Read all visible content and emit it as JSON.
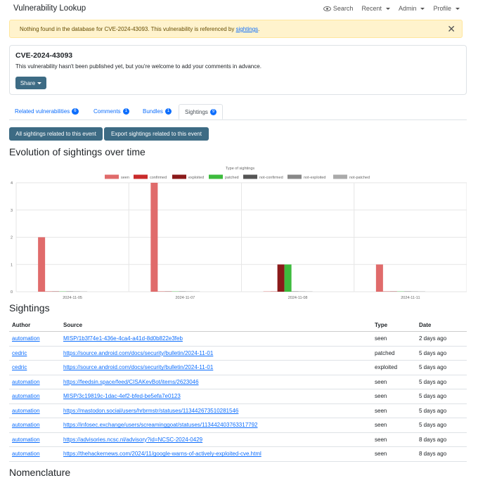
{
  "navbar": {
    "brand": "Vulnerability Lookup",
    "search": "Search",
    "recent": "Recent",
    "admin": "Admin",
    "profile": "Profile"
  },
  "alert": {
    "text": "Nothing found in the database for CVE-2024-43093. This vulnerability is referenced by ",
    "link": "sightings",
    "suffix": "."
  },
  "card": {
    "title": "CVE-2024-43093",
    "description": "This vulnerability hasn't been published yet, but you're welcome to add your comments in advance.",
    "share": "Share"
  },
  "tabs": [
    {
      "label": "Related vulnerabilities",
      "count": "6"
    },
    {
      "label": "Comments",
      "count": "1"
    },
    {
      "label": "Bundles",
      "count": "1"
    },
    {
      "label": "Sightings",
      "count": "9"
    }
  ],
  "buttons": {
    "all_sightings": "All sightings related to this event",
    "export_sightings": "Export sightings related to this event"
  },
  "headings": {
    "evolution": "Evolution of sightings over time",
    "sightings": "Sightings",
    "nomenclature": "Nomenclature"
  },
  "chart_data": {
    "type": "bar",
    "title": "Type of sightings",
    "categories": [
      "2024-11-05",
      "2024-11-07",
      "2024-11-08",
      "2024-11-11"
    ],
    "ylim": [
      0,
      4
    ],
    "yticks": [
      "0",
      "1",
      "2",
      "3",
      "4"
    ],
    "legend_position": "top",
    "grid": true,
    "series": [
      {
        "name": "seen",
        "color": "#e06b6b",
        "values": [
          2,
          4,
          0,
          1
        ]
      },
      {
        "name": "confirmed",
        "color": "#c92b2b",
        "values": [
          0,
          0,
          0,
          0
        ]
      },
      {
        "name": "exploited",
        "color": "#8b1a1a",
        "values": [
          0,
          0,
          1,
          0
        ]
      },
      {
        "name": "patched",
        "color": "#3dbb3d",
        "values": [
          0,
          0,
          1,
          0
        ]
      },
      {
        "name": "not-confirmed",
        "color": "#555555",
        "values": [
          0,
          0,
          0,
          0
        ]
      },
      {
        "name": "not-exploited",
        "color": "#888888",
        "values": [
          0,
          0,
          0,
          0
        ]
      },
      {
        "name": "not-patched",
        "color": "#aaaaaa",
        "values": [
          0,
          0,
          0,
          0
        ]
      }
    ]
  },
  "table": {
    "headers": [
      "Author",
      "Source",
      "Type",
      "Date"
    ],
    "rows": [
      {
        "author": "automation",
        "source": "MISP/1b3f74e1-436e-4ca4-a41d-8d0b822e3feb",
        "type": "seen",
        "date": "2 days ago"
      },
      {
        "author": "cedric",
        "source": "https://source.android.com/docs/security/bulletin/2024-11-01",
        "type": "patched",
        "date": "5 days ago"
      },
      {
        "author": "cedric",
        "source": "https://source.android.com/docs/security/bulletin/2024-11-01",
        "type": "exploited",
        "date": "5 days ago"
      },
      {
        "author": "automation",
        "source": "https://feedsin.space/feed/CISAKevBot/items/2623046",
        "type": "seen",
        "date": "5 days ago"
      },
      {
        "author": "automation",
        "source": "MISP/3c19819c-1dac-4ef2-bfed-be5efa7e0123",
        "type": "seen",
        "date": "5 days ago"
      },
      {
        "author": "automation",
        "source": "https://mastodon.social/users/hrbrmstr/statuses/113442673510281546",
        "type": "seen",
        "date": "5 days ago"
      },
      {
        "author": "automation",
        "source": "https://infosec.exchange/users/screaminggoat/statuses/113442403763317792",
        "type": "seen",
        "date": "5 days ago"
      },
      {
        "author": "automation",
        "source": "https://advisories.ncsc.nl/advisory?id=NCSC-2024-0429",
        "type": "seen",
        "date": "8 days ago"
      },
      {
        "author": "automation",
        "source": "https://thehackernews.com/2024/11/google-warns-of-actively-exploited-cve.html",
        "type": "seen",
        "date": "8 days ago"
      }
    ]
  }
}
